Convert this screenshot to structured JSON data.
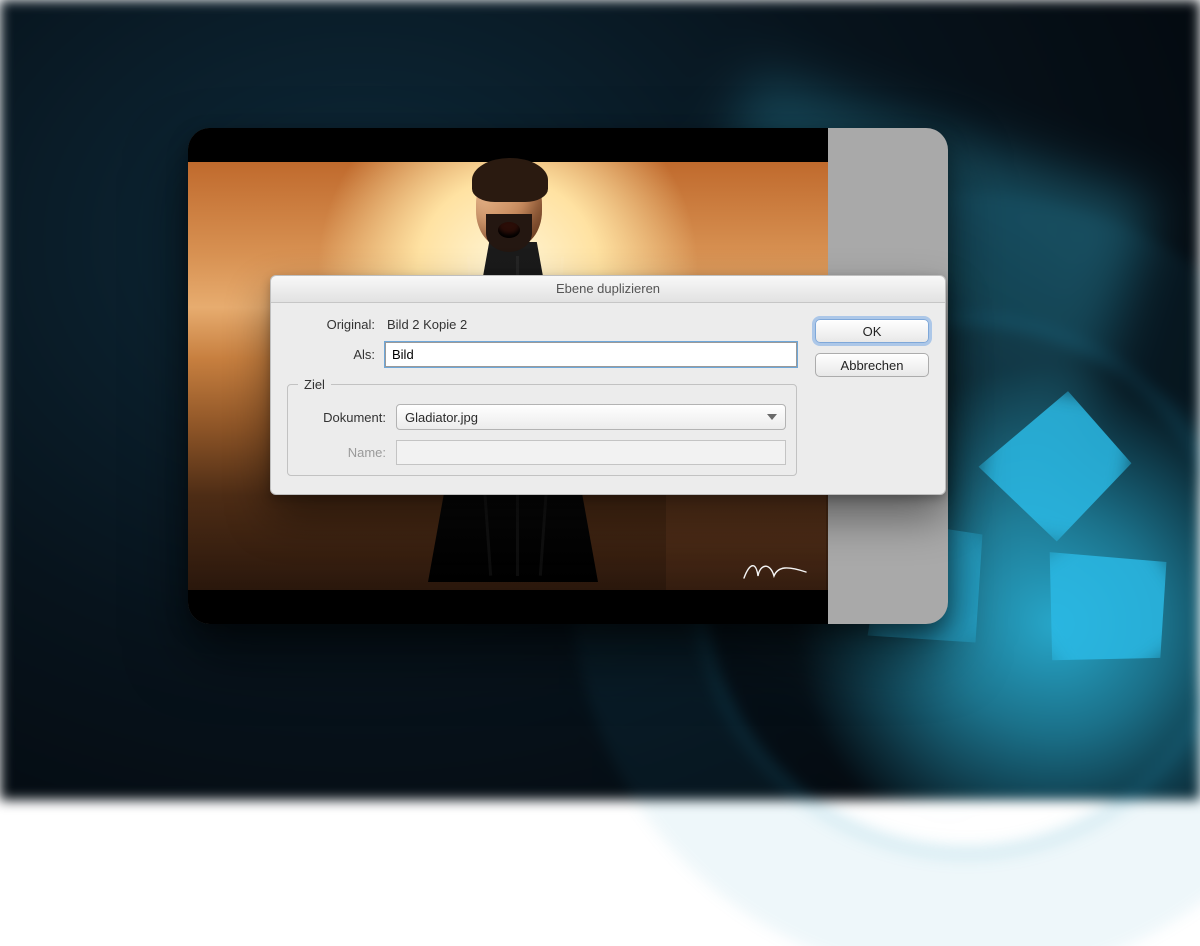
{
  "dialog": {
    "title": "Ebene duplizieren",
    "original_label": "Original:",
    "original_value": "Bild 2 Kopie 2",
    "as_label": "Als:",
    "as_value": "Bild",
    "dest_legend": "Ziel",
    "document_label": "Dokument:",
    "document_value": "Gladiator.jpg",
    "name_label": "Name:",
    "name_value": "",
    "ok_label": "OK",
    "cancel_label": "Abbrechen"
  }
}
